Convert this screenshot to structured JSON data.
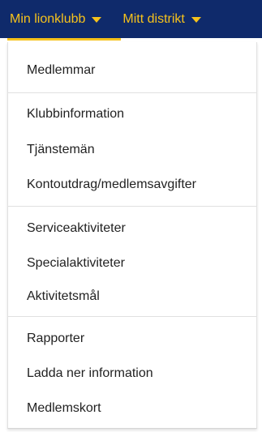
{
  "nav": {
    "primary_label": "Min lionklubb",
    "secondary_label": "Mitt distrikt",
    "accent_color": "#f6c21c",
    "background_color": "#0f2a6b"
  },
  "menu": {
    "groups": [
      {
        "items": [
          "Medlemmar"
        ]
      },
      {
        "items": [
          "Klubbinformation",
          "Tjänstemän",
          "Kontoutdrag/medlemsavgifter"
        ]
      },
      {
        "items": [
          "Serviceaktiviteter",
          "Specialaktiviteter",
          "Aktivitetsmål"
        ]
      },
      {
        "items": [
          "Rapporter",
          "Ladda ner information",
          "Medlemskort"
        ]
      }
    ]
  }
}
